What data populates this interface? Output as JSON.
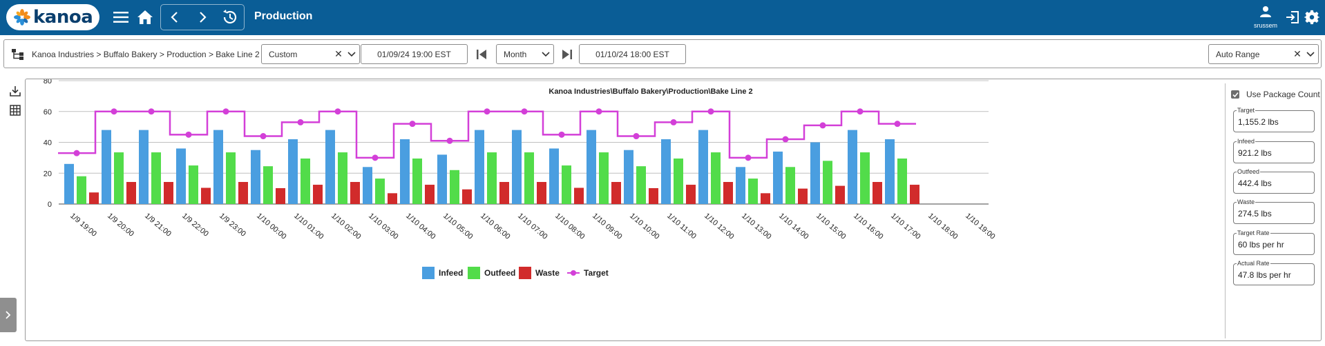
{
  "app": {
    "brand": "kanoa",
    "page_title": "Production",
    "user_name": "srussem"
  },
  "icons": {
    "menu": "menu-icon",
    "home": "home-icon",
    "back": "chevron-left-icon",
    "forward": "chevron-right-icon",
    "history": "history-icon",
    "user": "user-icon",
    "logout": "logout-icon",
    "settings": "gear-icon"
  },
  "filters": {
    "breadcrumb": "Kanoa Industries > Buffalo Bakery > Production > Bake Line 2",
    "range_mode": "Custom",
    "start": "01/09/24 19:00 EST",
    "period": "Month",
    "end": "01/10/24 18:00 EST",
    "axis_mode": "Auto Range"
  },
  "side": {
    "use_package_count": "Use Package Count",
    "stats": [
      {
        "label": "Target",
        "value": "1,155.2  lbs"
      },
      {
        "label": "Infeed",
        "value": "921.2  lbs"
      },
      {
        "label": "Outfeed",
        "value": "442.4  lbs"
      },
      {
        "label": "Waste",
        "value": "274.5  lbs"
      },
      {
        "label": "Target Rate",
        "value": "60  lbs per hr"
      },
      {
        "label": "Actual Rate",
        "value": "47.8  lbs per hr"
      }
    ]
  },
  "colors": {
    "topbar": "#0a5d96",
    "infeed": "#4a9ee0",
    "outfeed": "#52dc4a",
    "waste": "#d12b2b",
    "target": "#d33fd8"
  },
  "chart_data": {
    "type": "bar",
    "title": "Kanoa Industries\\Buffalo Bakery\\Production\\Bake Line 2",
    "categories": [
      "1/9 19:00",
      "1/9 20:00",
      "1/9 21:00",
      "1/9 22:00",
      "1/9 23:00",
      "1/10 00:00",
      "1/10 01:00",
      "1/10 02:00",
      "1/10 03:00",
      "1/10 04:00",
      "1/10 05:00",
      "1/10 06:00",
      "1/10 07:00",
      "1/10 08:00",
      "1/10 09:00",
      "1/10 10:00",
      "1/10 11:00",
      "1/10 12:00",
      "1/10 13:00",
      "1/10 14:00",
      "1/10 15:00",
      "1/10 16:00",
      "1/10 17:00",
      "1/10 18:00",
      "1/10 19:00"
    ],
    "ylim": [
      0,
      80
    ],
    "yticks": [
      0,
      20,
      40,
      60,
      80
    ],
    "grid": true,
    "legend_position": "bottom",
    "series": [
      {
        "name": "Infeed",
        "type": "bar",
        "values": [
          26,
          48,
          48,
          36,
          48,
          35,
          42,
          48,
          24,
          42,
          32,
          48,
          48,
          36,
          48,
          35,
          42,
          48,
          24,
          34,
          40,
          48,
          42
        ]
      },
      {
        "name": "Outfeed",
        "type": "bar",
        "values": [
          18,
          33.5,
          33.5,
          25,
          33.5,
          24.5,
          29.5,
          33.5,
          16.5,
          29.5,
          22,
          33.5,
          33.5,
          25,
          33.5,
          24.5,
          29.5,
          33.5,
          16.5,
          24,
          28,
          33.5,
          29.5
        ]
      },
      {
        "name": "Waste",
        "type": "bar",
        "values": [
          7.5,
          14.3,
          14.3,
          10.5,
          14.3,
          10.3,
          12.5,
          14.3,
          7,
          12.5,
          9.5,
          14.3,
          14.3,
          10.5,
          14.3,
          10.3,
          12.5,
          14.3,
          7,
          10,
          11.8,
          14.3,
          12.5
        ]
      },
      {
        "name": "Target",
        "type": "step-line",
        "values": [
          33,
          60,
          60,
          45,
          60,
          44,
          53,
          60,
          30,
          52,
          41,
          60,
          60,
          45,
          60,
          44,
          53,
          60,
          30,
          42,
          51,
          60,
          52
        ]
      }
    ]
  }
}
